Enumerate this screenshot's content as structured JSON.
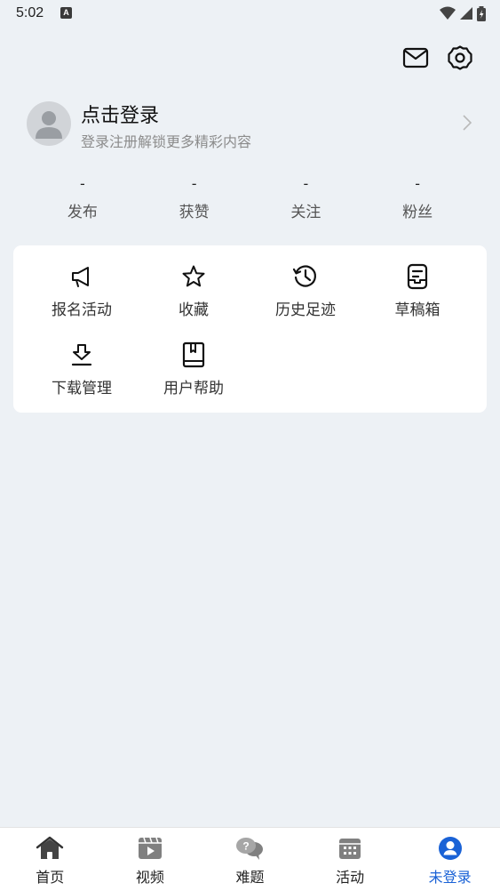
{
  "status_bar": {
    "time": "5:02",
    "a_glyph": "A"
  },
  "header": {
    "icons": [
      "mail-icon",
      "gear-icon"
    ]
  },
  "profile": {
    "title": "点击登录",
    "subtitle": "登录注册解锁更多精彩内容"
  },
  "stats": [
    {
      "value": "-",
      "label": "发布"
    },
    {
      "value": "-",
      "label": "获赞"
    },
    {
      "value": "-",
      "label": "关注"
    },
    {
      "value": "-",
      "label": "粉丝"
    }
  ],
  "menu": [
    {
      "label": "报名活动",
      "icon": "megaphone-icon"
    },
    {
      "label": "收藏",
      "icon": "star-icon"
    },
    {
      "label": "历史足迹",
      "icon": "history-icon"
    },
    {
      "label": "草稿箱",
      "icon": "drafts-icon"
    },
    {
      "label": "下载管理",
      "icon": "download-icon"
    },
    {
      "label": "用户帮助",
      "icon": "help-book-icon"
    }
  ],
  "bottom_nav": [
    {
      "label": "首页",
      "icon": "home-icon"
    },
    {
      "label": "视频",
      "icon": "video-icon"
    },
    {
      "label": "难题",
      "icon": "question-icon"
    },
    {
      "label": "活动",
      "icon": "calendar-icon"
    },
    {
      "label": "未登录",
      "icon": "user-icon",
      "active": true
    }
  ],
  "colors": {
    "accent": "#1a62d6",
    "background": "#edf1f5",
    "card": "#ffffff"
  }
}
